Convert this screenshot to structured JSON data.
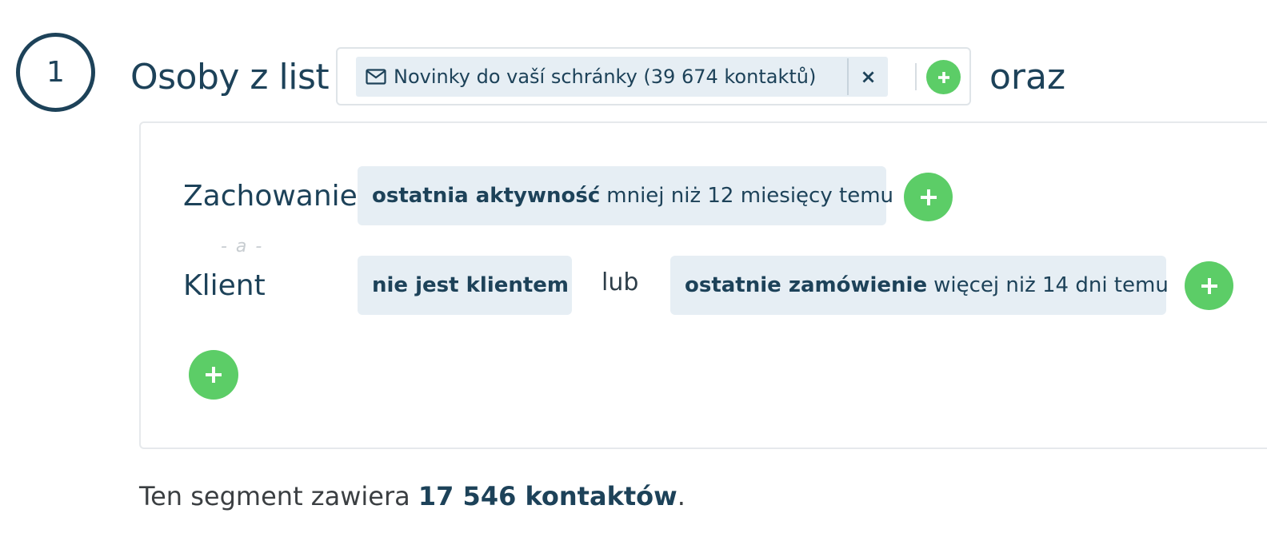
{
  "step": {
    "number": "1"
  },
  "header": {
    "title": "Osoby z list",
    "conjunction": "oraz"
  },
  "list_selector": {
    "chip_icon": "envelope-icon",
    "chip_label": "Novinky do vaší schránky (39 674 kontaktů)",
    "remove_label": "×"
  },
  "conditions": {
    "separator": "- a -",
    "rows": [
      {
        "label": "Zachowanie",
        "chips": [
          {
            "bold": "ostatnia aktywność",
            "text": "mniej niż 12 miesięcy temu"
          }
        ]
      },
      {
        "label": "Klient",
        "chips": [
          {
            "bold": "nie jest klientem",
            "text": ""
          },
          {
            "bold": "ostatnie zamówienie",
            "text": "więcej niż 14 dni temu"
          }
        ],
        "joiner": "lub"
      }
    ]
  },
  "summary": {
    "prefix": "Ten segment zawiera",
    "count": "17 546 kontaktów",
    "suffix": "."
  },
  "colors": {
    "primary": "#1d4259",
    "chip_bg": "#e6eef4",
    "add_button": "#5ccd67"
  }
}
